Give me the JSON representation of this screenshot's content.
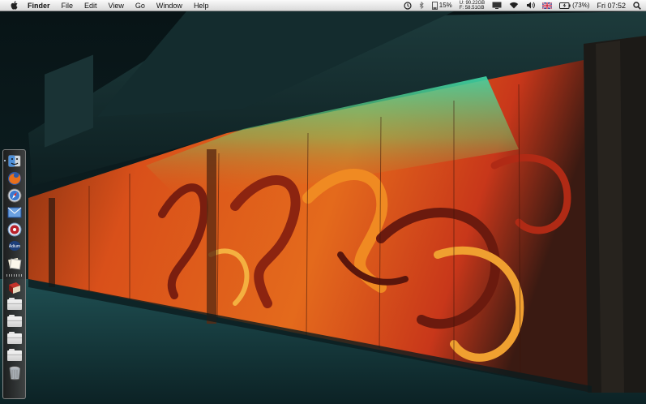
{
  "menubar": {
    "app_name": "Finder",
    "menus": [
      "File",
      "Edit",
      "View",
      "Go",
      "Window",
      "Help"
    ],
    "status": {
      "cpu": "15%",
      "disk_used": "90.22GB",
      "disk_free": "58.51GB",
      "disk_label_u": "U:",
      "disk_label_f": "F:",
      "battery": "(73%)",
      "clock": "Fri 07:52"
    }
  },
  "dock": {
    "items": [
      {
        "name": "finder",
        "running": true
      },
      {
        "name": "firefox",
        "running": false
      },
      {
        "name": "safari",
        "running": false
      },
      {
        "name": "mail",
        "running": false
      },
      {
        "name": "itunes",
        "running": false
      },
      {
        "name": "adium",
        "running": false,
        "label": "Adium"
      },
      {
        "name": "preview",
        "running": false
      }
    ],
    "stack_items": [
      "book",
      "folder",
      "folder",
      "folder",
      "folder",
      "trash"
    ]
  },
  "colors": {
    "menubar": "#e6e6e6",
    "wall_orange": "#e8561a",
    "wall_teal": "#2fd6a4",
    "sky": "#0b1a1d"
  }
}
